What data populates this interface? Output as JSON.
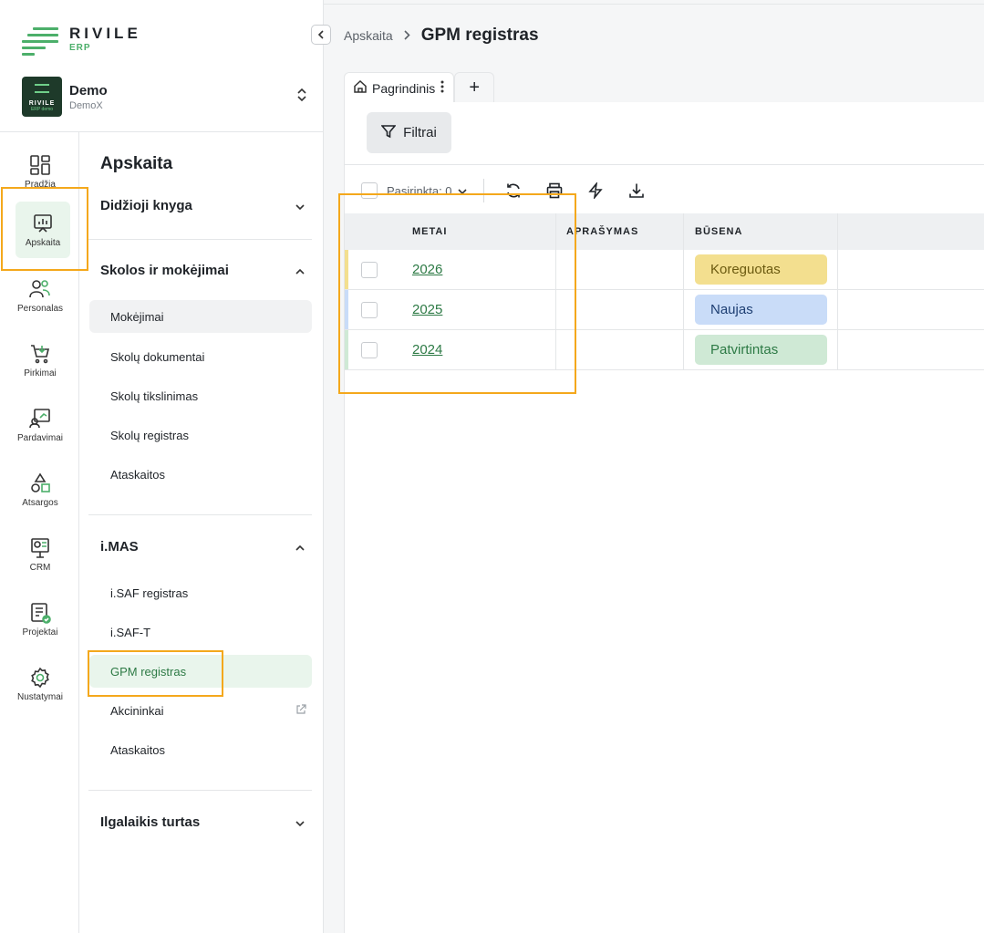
{
  "logo": {
    "brand": "RIVILE",
    "sub": "ERP"
  },
  "company": {
    "name": "Demo",
    "code": "DemoX",
    "badge_text": "RIVILE",
    "badge_sub": "ERP demo"
  },
  "rail": [
    {
      "label": "Pradžia",
      "icon": "home-grid-icon"
    },
    {
      "label": "Apskaita",
      "icon": "chart-board-icon",
      "active": true
    },
    {
      "label": "Personalas",
      "icon": "people-icon"
    },
    {
      "label": "Pirkimai",
      "icon": "cart-icon"
    },
    {
      "label": "Pardavimai",
      "icon": "sales-icon"
    },
    {
      "label": "Atsargos",
      "icon": "shapes-icon"
    },
    {
      "label": "CRM",
      "icon": "crm-icon"
    },
    {
      "label": "Projektai",
      "icon": "projects-icon"
    },
    {
      "label": "Nustatymai",
      "icon": "gear-icon"
    }
  ],
  "nav": {
    "title": "Apskaita",
    "groups": [
      {
        "label": "Didžioji knyga",
        "expanded": false
      },
      {
        "label": "Skolos ir mokėjimai",
        "expanded": true,
        "items": [
          "Mokėjimai",
          "Skolų dokumentai",
          "Skolų tikslinimas",
          "Skolų registras",
          "Ataskaitos"
        ]
      },
      {
        "label": "i.MAS",
        "expanded": true,
        "items": [
          "i.SAF registras",
          "i.SAF-T",
          "GPM registras",
          "Akcininkai",
          "Ataskaitos"
        ]
      },
      {
        "label": "Ilgalaikis turtas",
        "expanded": false
      }
    ]
  },
  "breadcrumb": {
    "parent": "Apskaita",
    "title": "GPM registras"
  },
  "tabs": {
    "main": "Pagrindinis",
    "add": "+"
  },
  "filter_label": "Filtrai",
  "toolbar": {
    "selected_label": "Pasirinkta: 0"
  },
  "columns": [
    "METAI",
    "APRAŠYMAS",
    "BŪSENA"
  ],
  "rows": [
    {
      "year": "2026",
      "description": "",
      "status": "Koreguotas",
      "status_bg": "#f3df8f",
      "status_fg": "#6b5a10",
      "bar": "#f3df8f"
    },
    {
      "year": "2025",
      "description": "",
      "status": "Naujas",
      "status_bg": "#c9dcf8",
      "status_fg": "#1e3f73",
      "bar": "#c9dcf8"
    },
    {
      "year": "2024",
      "description": "",
      "status": "Patvirtintas",
      "status_bg": "#cfe9d5",
      "status_fg": "#2d7a45",
      "bar": "#cfe9d5"
    }
  ],
  "colors": {
    "accent": "#4caf6a",
    "highlight": "#f4a81c"
  }
}
